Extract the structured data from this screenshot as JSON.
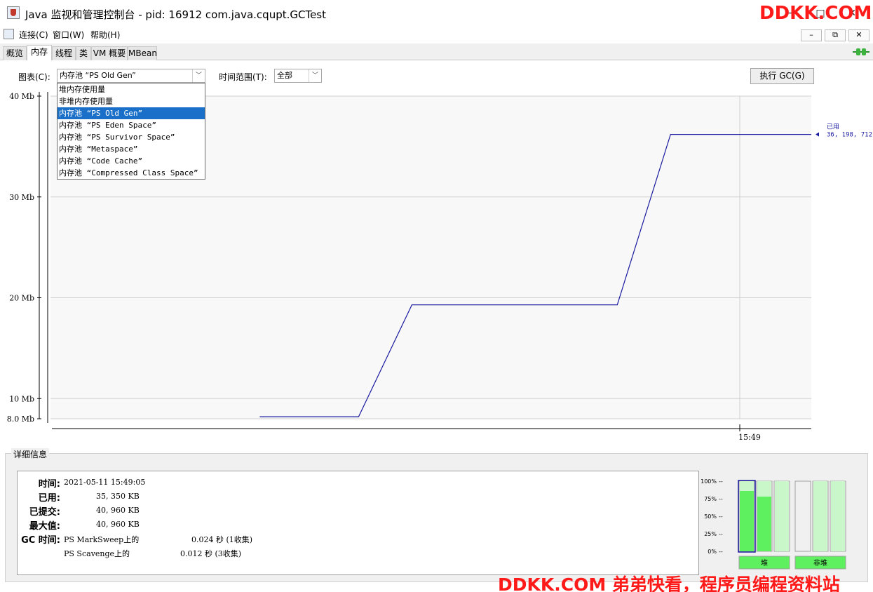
{
  "window": {
    "title": "Java 监视和管理控制台 - pid: 16912 com.java.cqupt.GCTest",
    "minimize": "−",
    "maximize": "□",
    "close": "✕"
  },
  "menu": {
    "items": [
      "连接(C)",
      "窗口(W)",
      "帮助(H)"
    ],
    "mdi_minimize": "–",
    "mdi_restore": "⧉",
    "mdi_close": "✕"
  },
  "tabs": [
    "概览",
    "内存",
    "线程",
    "类",
    "VM 概要",
    "MBean"
  ],
  "active_tab": "内存",
  "controls": {
    "chart_label": "图表(C):",
    "chart_selected": "内存池 “PS Old Gen”",
    "range_label": "时间范围(T):",
    "range_selected": "全部",
    "gc_button": "执行 GC(G)"
  },
  "dropdown": {
    "options": [
      "堆内存使用量",
      "非堆内存使用量",
      "内存池 “PS Old Gen”",
      "内存池 “PS Eden Space”",
      "内存池 “PS Survivor Space”",
      "内存池 “Metaspace”",
      "内存池 “Code Cache”",
      "内存池 “Compressed Class Space”"
    ],
    "selected_index": 2
  },
  "chart_data": {
    "type": "line",
    "y_unit": "Mb",
    "ylim": [
      8.0,
      40
    ],
    "yticks": [
      8.0,
      10,
      20,
      30,
      40
    ],
    "ytick_labels": [
      "8.0 Mb",
      "10 Mb",
      "20 Mb",
      "30 Mb",
      "40 Mb"
    ],
    "xtick_labels": [
      "15:49"
    ],
    "series": [
      {
        "name": "已用",
        "color": "#1a1aa0",
        "points": [
          {
            "t": 0.275,
            "mb": 8.2
          },
          {
            "t": 0.405,
            "mb": 8.2
          },
          {
            "t": 0.475,
            "mb": 19.3
          },
          {
            "t": 0.745,
            "mb": 19.3
          },
          {
            "t": 0.815,
            "mb": 36.2
          },
          {
            "t": 1.0,
            "mb": 36.2
          }
        ]
      }
    ],
    "latest": {
      "label": "已用",
      "value": "36, 198, 712"
    }
  },
  "details": {
    "title": "详细信息",
    "time_label": "时间:",
    "time_value": "2021-05-11 15:49:05",
    "used_label": "已用:",
    "used_value": "35, 350 KB",
    "committed_label": "已提交:",
    "committed_value": "40, 960 KB",
    "max_label": "最大值:",
    "max_value": "40, 960 KB",
    "gc_label": "GC 时间:",
    "gc_rows": [
      {
        "name": "PS MarkSweep上的",
        "value": "0.024 秒 (1收集)"
      },
      {
        "name": "PS Scavenge上的",
        "value": "0.012 秒 (3收集)"
      }
    ]
  },
  "bars": {
    "ticks": [
      "100%",
      "75%",
      "50%",
      "25%",
      "0%"
    ],
    "heap_label": "堆",
    "nonheap_label": "非堆",
    "heap": [
      {
        "used": 0.86,
        "committed": 1.0,
        "selected": true
      },
      {
        "used": 0.78,
        "committed": 1.0,
        "selected": false
      },
      {
        "used": 0.0,
        "committed": 1.0,
        "selected": false
      }
    ],
    "nonheap": [
      {
        "used": 0.0,
        "committed": 0.0,
        "selected": false
      },
      {
        "used": 0.0,
        "committed": 1.0,
        "selected": false
      },
      {
        "used": 0.0,
        "committed": 1.0,
        "selected": false
      }
    ]
  },
  "watermark": {
    "top": "DDKK.COM",
    "bottom": "DDKK.COM 弟弟快看，程序员编程资料站"
  },
  "colors": {
    "line": "#1a1aa0",
    "selection": "#1a6fc9",
    "bar_used": "#5ef05e",
    "bar_committed": "#c9f7c9",
    "watermark": "#ff1a1a"
  }
}
